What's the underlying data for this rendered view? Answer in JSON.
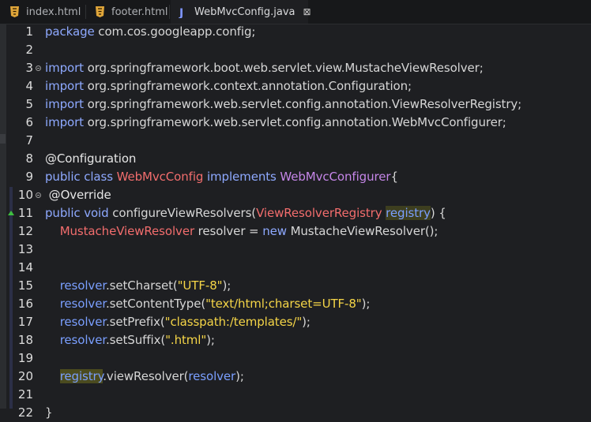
{
  "tabs": [
    {
      "label": "index.html",
      "icon": "html-file-icon"
    },
    {
      "label": "footer.html",
      "icon": "html-file-icon"
    },
    {
      "label": "WebMvcConfig.java",
      "icon": "java-file-icon",
      "close": "⊠"
    }
  ],
  "lines": [
    {
      "n": "1",
      "segs": [
        {
          "t": "package ",
          "c": "kw"
        },
        {
          "t": "com.cos.googleapp.config;",
          "c": "nm"
        }
      ]
    },
    {
      "n": "2",
      "segs": []
    },
    {
      "n": "3",
      "fold": true,
      "segs": [
        {
          "t": "import ",
          "c": "kw"
        },
        {
          "t": "org.springframework.boot.web.servlet.view.MustacheViewResolver;",
          "c": "nm"
        }
      ]
    },
    {
      "n": "4",
      "segs": [
        {
          "t": "import ",
          "c": "kw"
        },
        {
          "t": "org.springframework.context.annotation.Configuration;",
          "c": "nm"
        }
      ]
    },
    {
      "n": "5",
      "segs": [
        {
          "t": "import ",
          "c": "kw"
        },
        {
          "t": "org.springframework.web.servlet.config.annotation.ViewResolverRegistry;",
          "c": "nm"
        }
      ]
    },
    {
      "n": "6",
      "segs": [
        {
          "t": "import ",
          "c": "kw"
        },
        {
          "t": "org.springframework.web.servlet.config.annotation.WebMvcConfigurer;",
          "c": "nm"
        }
      ]
    },
    {
      "n": "7",
      "segs": []
    },
    {
      "n": "8",
      "segs": [
        {
          "t": "@Configuration",
          "c": "ann"
        }
      ]
    },
    {
      "n": "9",
      "segs": [
        {
          "t": "public class ",
          "c": "kw"
        },
        {
          "t": "WebMvcConfig",
          "c": "ty"
        },
        {
          "t": " implements ",
          "c": "kw"
        },
        {
          "t": "WebMvcConfigurer",
          "c": "ty2"
        },
        {
          "t": "{",
          "c": "nm"
        }
      ]
    },
    {
      "n": "10",
      "fold": true,
      "segs": [
        {
          "t": " @Override",
          "c": "ann"
        }
      ]
    },
    {
      "n": "11",
      "override": true,
      "segs": [
        {
          "t": "public void ",
          "c": "kw"
        },
        {
          "t": "configureViewResolvers(",
          "c": "nm"
        },
        {
          "t": "ViewResolverRegistry",
          "c": "ty"
        },
        {
          "t": " ",
          "c": "nm"
        },
        {
          "t": "registry",
          "c": "fld occ"
        },
        {
          "t": ") {",
          "c": "nm"
        }
      ]
    },
    {
      "n": "12",
      "segs": [
        {
          "t": "    ",
          "c": "nm"
        },
        {
          "t": "MustacheViewResolver",
          "c": "ty"
        },
        {
          "t": " resolver = ",
          "c": "nm"
        },
        {
          "t": "new ",
          "c": "kw"
        },
        {
          "t": "MustacheViewResolver();",
          "c": "nm"
        }
      ]
    },
    {
      "n": "13",
      "segs": []
    },
    {
      "n": "14",
      "segs": []
    },
    {
      "n": "15",
      "segs": [
        {
          "t": "    ",
          "c": "nm"
        },
        {
          "t": "resolver",
          "c": "fld"
        },
        {
          "t": ".setCharset(",
          "c": "nm"
        },
        {
          "t": "\"UTF-8\"",
          "c": "str"
        },
        {
          "t": ");",
          "c": "nm"
        }
      ]
    },
    {
      "n": "16",
      "segs": [
        {
          "t": "    ",
          "c": "nm"
        },
        {
          "t": "resolver",
          "c": "fld"
        },
        {
          "t": ".setContentType(",
          "c": "nm"
        },
        {
          "t": "\"text/html;charset=UTF-8\"",
          "c": "str"
        },
        {
          "t": ");",
          "c": "nm"
        }
      ]
    },
    {
      "n": "17",
      "segs": [
        {
          "t": "    ",
          "c": "nm"
        },
        {
          "t": "resolver",
          "c": "fld"
        },
        {
          "t": ".setPrefix(",
          "c": "nm"
        },
        {
          "t": "\"classpath:/templates/\"",
          "c": "str"
        },
        {
          "t": ");",
          "c": "nm"
        }
      ]
    },
    {
      "n": "18",
      "segs": [
        {
          "t": "    ",
          "c": "nm"
        },
        {
          "t": "resolver",
          "c": "fld"
        },
        {
          "t": ".setSuffix(",
          "c": "nm"
        },
        {
          "t": "\".html\"",
          "c": "str"
        },
        {
          "t": ");",
          "c": "nm"
        }
      ]
    },
    {
      "n": "19",
      "segs": []
    },
    {
      "n": "20",
      "segs": [
        {
          "t": "    ",
          "c": "nm"
        },
        {
          "t": "registry",
          "c": "fld orch"
        },
        {
          "t": ".viewResolver(",
          "c": "nm"
        },
        {
          "t": "resolver",
          "c": "fld"
        },
        {
          "t": ");",
          "c": "nm"
        }
      ]
    },
    {
      "n": "21",
      "segs": []
    },
    {
      "n": "22",
      "segs": [
        {
          "t": "}",
          "c": "nm"
        }
      ]
    }
  ]
}
